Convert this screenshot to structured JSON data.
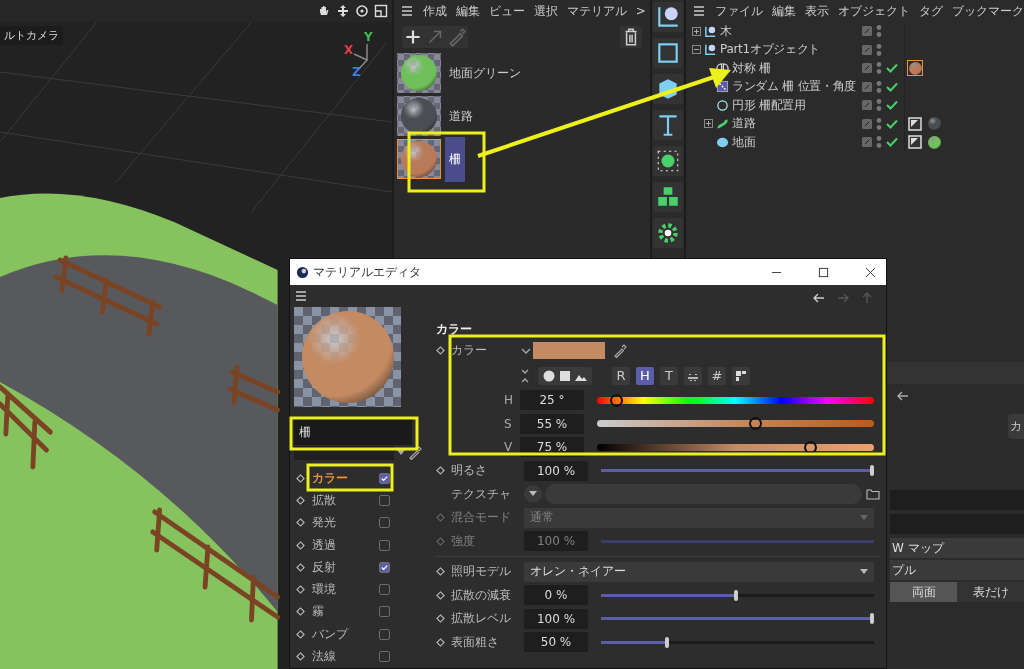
{
  "viewport": {
    "camera_label": "ルトカメラ",
    "axes": [
      {
        "label": "Y",
        "color": "#3fbf4f"
      },
      {
        "label": "X",
        "color": "#e04040"
      },
      {
        "label": "Z",
        "color": "#3f7fe0"
      }
    ]
  },
  "material_manager": {
    "menu": [
      "作成",
      "編集",
      "ビュー",
      "選択",
      "マテリアル",
      ">"
    ],
    "materials": [
      {
        "name": "地面グリーン",
        "color": "#6fbf5a",
        "selected": false
      },
      {
        "name": "道路",
        "color": "#4a4d52",
        "selected": false
      },
      {
        "name": "柵",
        "color": "#b97a5a",
        "selected": true
      }
    ]
  },
  "object_manager": {
    "menu": [
      "ファイル",
      "編集",
      "表示",
      "オブジェクト",
      "タグ",
      "ブックマーク"
    ],
    "objects": [
      {
        "name": "木",
        "kind": "null",
        "expanded": false
      },
      {
        "name": "Part1オブジェクト",
        "kind": "null",
        "expanded": true,
        "children": [
          {
            "name": "対称 柵",
            "kind": "symmetry",
            "enabled": true,
            "tags": [
              {
                "kind": "material",
                "color": "#b97a5a",
                "selected": true
              }
            ]
          },
          {
            "name": "ランダム 柵 位置・角度",
            "kind": "random",
            "enabled": true
          },
          {
            "name": "円形 柵配置用",
            "kind": "circle",
            "enabled": true
          },
          {
            "name": "道路",
            "kind": "sweep",
            "expanded": false,
            "enabled": true,
            "tags": [
              {
                "kind": "uvw"
              },
              {
                "kind": "material",
                "color": "#4a4d52",
                "selected": false
              }
            ]
          },
          {
            "name": "地面",
            "kind": "sphere",
            "enabled": true,
            "tags": [
              {
                "kind": "uvw"
              },
              {
                "kind": "material",
                "color": "#6fbf5a",
                "selected": false
              }
            ]
          }
        ]
      }
    ]
  },
  "attributes": {
    "tab": "カ",
    "rows": [
      "W マップ",
      "プル"
    ],
    "toggle": [
      {
        "label": "両面",
        "selected": true
      },
      {
        "label": "表だけ",
        "selected": false
      }
    ]
  },
  "material_editor": {
    "title": "マテリアルエディタ",
    "name": "柵",
    "channels": [
      {
        "label": "カラー",
        "checked": true,
        "selected": true
      },
      {
        "label": "拡散",
        "checked": false,
        "selected": false
      },
      {
        "label": "発光",
        "checked": false,
        "selected": false
      },
      {
        "label": "透過",
        "checked": false,
        "selected": false
      },
      {
        "label": "反射",
        "checked": true,
        "selected": false
      },
      {
        "label": "環境",
        "checked": false,
        "selected": false
      },
      {
        "label": "霧",
        "checked": false,
        "selected": false
      },
      {
        "label": "バンプ",
        "checked": false,
        "selected": false
      },
      {
        "label": "法線",
        "checked": false,
        "selected": false
      }
    ],
    "section_title": "カラー",
    "color_param": {
      "label": "カラー",
      "color": "#c48a62"
    },
    "modes": [
      {
        "kind": "text",
        "label": "R",
        "selected": false
      },
      {
        "kind": "text",
        "label": "H",
        "selected": true
      },
      {
        "kind": "text",
        "label": "T",
        "selected": false
      },
      {
        "kind": "mixer",
        "selected": false
      },
      {
        "kind": "text",
        "label": "#",
        "selected": false
      },
      {
        "kind": "palette",
        "selected": false
      }
    ],
    "hsv": [
      {
        "kind": "hue",
        "label": "H",
        "value": "25 °",
        "level": 0.07
      },
      {
        "kind": "saturation",
        "label": "S",
        "value": "55 %",
        "level": 0.57
      },
      {
        "kind": "value",
        "label": "V",
        "value": "75 %",
        "level": 0.77
      }
    ],
    "params": [
      {
        "kind": "slider",
        "label": "明るさ",
        "value": "100 %",
        "level": 1,
        "disabled": false
      },
      {
        "kind": "texture",
        "label": "テクスチャ"
      },
      {
        "kind": "dropdown",
        "label": "混合モード",
        "value": "通常",
        "disabled": true
      },
      {
        "kind": "slider",
        "label": "強度",
        "value": "100 %",
        "level": 1,
        "disabled": true
      },
      {
        "kind": "separator"
      },
      {
        "kind": "dropdown",
        "label": "照明モデル",
        "value": "オレン・ネイアー",
        "disabled": false
      },
      {
        "kind": "slider",
        "label": "拡散の減衰",
        "value": "0 %",
        "level": 0.5,
        "disabled": false
      },
      {
        "kind": "slider",
        "label": "拡散レベル",
        "value": "100 %",
        "level": 1,
        "disabled": false
      },
      {
        "kind": "slider",
        "label": "表面粗さ",
        "value": "50 %",
        "level": 0.25,
        "disabled": false
      }
    ]
  }
}
